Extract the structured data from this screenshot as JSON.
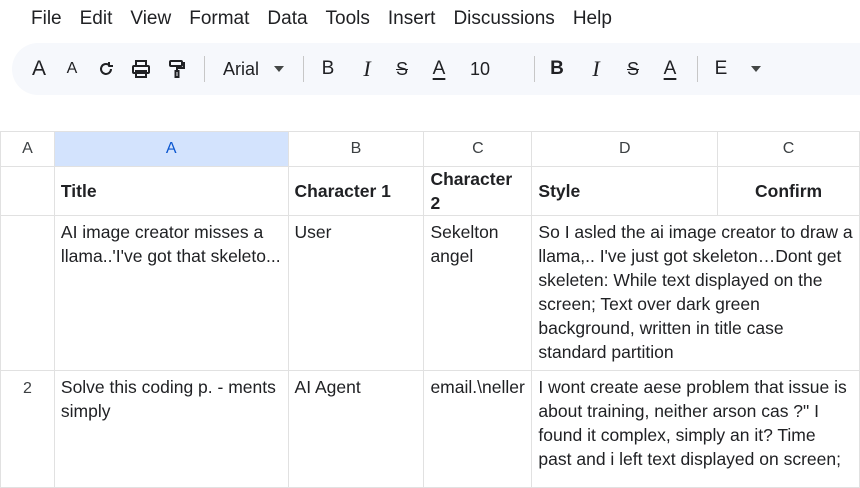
{
  "menu": [
    "File",
    "Edit",
    "View",
    "Format",
    "Data",
    "Tools",
    "Insert",
    "Discussions",
    "Help"
  ],
  "toolbar": {
    "font_name": "Arial",
    "font_size": "10",
    "glyph_a_big": "A",
    "glyph_a_small": "A",
    "glyph_bold_1": "B",
    "glyph_italic_1": "I",
    "glyph_strike_1": "S",
    "glyph_text_color_1": "A",
    "glyph_bold_2": "B",
    "glyph_italic_2": "I",
    "glyph_strike_2": "S",
    "glyph_text_color_2": "A",
    "glyph_e": "E"
  },
  "sheet": {
    "columns": [
      "A",
      "A",
      "B",
      "C",
      "D",
      "C"
    ],
    "header_row": [
      "Title",
      "Character 1",
      "Character 2",
      "Style",
      "Confirm"
    ],
    "rows": [
      {
        "label": "",
        "cells": [
          "AI image creator misses a llama..'I've got that skeleto...",
          "User",
          "Sekelton angel",
          "So I asled the ai image creator to draw a llama,.. I've just got skeleton…Dont get skeleten: While text displayed on the screen; Text over dark green background, written in title case standard partition",
          ""
        ]
      },
      {
        "label": "2",
        "cells": [
          "Solve this coding p. - ments simply",
          "AI Agent",
          "email.\\neller",
          "I wont create aese problem that issue is about training, neither arson cas ?\" I found it complex, simply an it? Time past and i left text displayed on screen;",
          ""
        ]
      }
    ]
  },
  "colors": {
    "selected_column_bg": "#d3e3fd",
    "selected_column_text": "#0b57d0",
    "toolbar_bg": "#f6f8fc",
    "grid_line": "#e1e1e1"
  }
}
